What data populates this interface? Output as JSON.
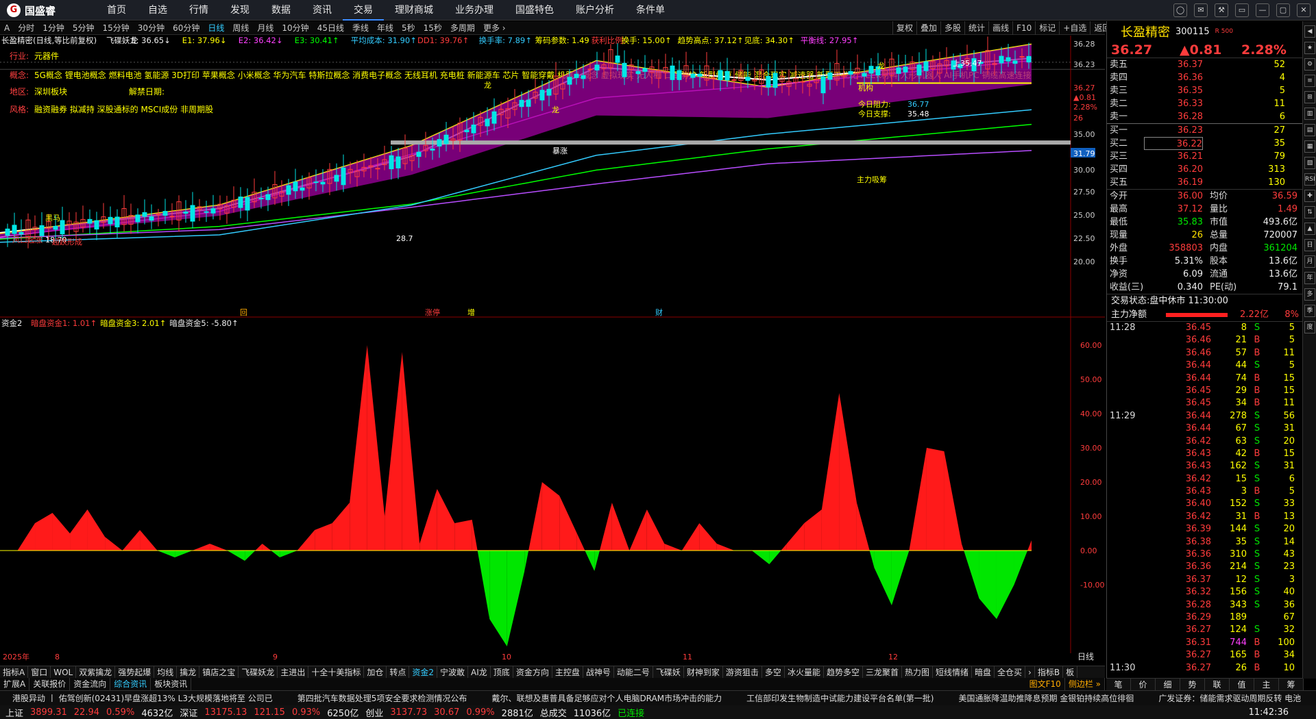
{
  "app": {
    "logo": "国盛睿",
    "logo_mark": "G"
  },
  "menu": [
    "首页",
    "自选",
    "行情",
    "发现",
    "数据",
    "资讯",
    "交易",
    "理财商城",
    "业务办理",
    "国盛特色",
    "账户分析",
    "条件单"
  ],
  "menu_active": 6,
  "window_controls": [
    "◯",
    "✉",
    "⚒",
    "▭",
    "—",
    "▢",
    "✕"
  ],
  "periods": [
    "A",
    "分时",
    "1分钟",
    "5分钟",
    "15分钟",
    "30分钟",
    "60分钟",
    "日线",
    "周线",
    "月线",
    "10分钟",
    "45日线",
    "季线",
    "年线",
    "5秒",
    "15秒",
    "多周期",
    "更多 ›"
  ],
  "period_active": 7,
  "chart_toolbar": [
    "复权",
    "叠加",
    "多股",
    "统计",
    "画线",
    "F10",
    "标记",
    "+自选",
    "返回"
  ],
  "main_legend": [
    {
      "text": "长盈精密(日线,等比前复权)",
      "color": "#eeeeee"
    },
    {
      "text": "飞碟妖龙",
      "color": "#eeeeee"
    },
    {
      "text": "E: 36.65↓",
      "color": "#eeeeee"
    },
    {
      "text": "E1: 37.96↓",
      "color": "#ffff00"
    },
    {
      "text": "E2: 36.42↓",
      "color": "#ff40ff"
    },
    {
      "text": "E3: 30.41↑",
      "color": "#00ff00"
    },
    {
      "text": "平均成本: 31.90↑",
      "color": "#33ccff"
    },
    {
      "text": "DD1: 39.76↑",
      "color": "#ff3c3c"
    },
    {
      "text": "换手率: 7.89↑",
      "color": "#33ccff"
    },
    {
      "text": "筹码参数: 1.49",
      "color": "#ffff00"
    },
    {
      "text": "获利比例:",
      "color": "#ff3c3c"
    },
    {
      "text": "换手: 15.00↑",
      "color": "#ffff00"
    },
    {
      "text": "趋势高点: 37.12↑",
      "color": "#ffff00"
    },
    {
      "text": "见底: 34.30↑",
      "color": "#ffff00"
    },
    {
      "text": "平衡线: 27.95↑",
      "color": "#ff40ff"
    }
  ],
  "info": {
    "industry_label": "行业:",
    "industry": "元器件",
    "concept_label": "概念:",
    "concepts": "5G概念 锂电池概念 燃料电池 氢能源 3D打印 苹果概念 小米概念 华为汽车 特斯拉概念 消费电子概念 无线耳机 充电桩 新能源车 芯片 智能穿戴 机器人概念 虚拟现实 无人机 口罩防护 新型烟草 储能 混合现实 减速器 新型工业化 PEEK材料 人形机器人 AI手机PC 铜缆高速连接",
    "region_label": "地区:",
    "region": "深圳板块",
    "unlock_label": "解禁日期:",
    "unlock": "",
    "style_label": "风格:",
    "style": "融资融券 拟减持 深股通标的 MSCI成份 非周期股"
  },
  "main_yaxis": [
    "36.28",
    "36.23",
    "36.27",
    "▲0.81",
    "2.28%",
    "26",
    "35.00",
    "31.79",
    "30.00",
    "27.50",
    "25.00",
    "22.50",
    "20.00"
  ],
  "chart_annotations": {
    "long1": "龙",
    "long2": "龙",
    "long3": "龙",
    "top": "上35.47",
    "buy_point": "主力吸筹",
    "big_up": "暴涨",
    "today_power": "今日阻力:",
    "today_val": "36.77",
    "short_support": "今日支撑:",
    "support_val": "35.48",
    "jiehe": "机构",
    "bottom_price": "28.7",
    "low_price": "18.70",
    "black_horse": "黑马",
    "wind": "风口起涨",
    "oversold": "超跌形成",
    "evt_zt": "涨停",
    "evt_zeng": "增",
    "evt_cai": "财",
    "evt_box": "回"
  },
  "sub_legend": [
    {
      "text": "资金2",
      "color": "#eeeeee"
    },
    {
      "text": "暗盘资金1: 1.01↑",
      "color": "#ff3c3c"
    },
    {
      "text": "暗盘资金3: 2.01↑",
      "color": "#ffff00"
    },
    {
      "text": "暗盘资金5: -5.80↑",
      "color": "#eeeeee"
    }
  ],
  "sub_yaxis": [
    "60.00",
    "50.00",
    "40.00",
    "30.00",
    "20.00",
    "10.00",
    "0.00",
    "-10.00"
  ],
  "xaxis": [
    "2025年",
    "8",
    "9",
    "10",
    "11",
    "12"
  ],
  "xaxis_right": "日线",
  "bottom_tabs": [
    "指标A",
    "窗口",
    "WOL",
    "双紫擒龙",
    "强势起爆",
    "均线",
    "擒龙",
    "镇店之宝",
    "飞碟妖龙",
    "主进出",
    "十全十美指标",
    "加仓",
    "转点",
    "资金2",
    "宁波敢",
    "AI龙",
    "顶底",
    "资金方向",
    "主控盘",
    "战神号",
    "动能二号",
    "飞碟妖",
    "财神到家",
    "游资狙击",
    "多空",
    "冰火量能",
    "趋势多空",
    "三龙聚首",
    "热力图",
    "短线情绪",
    "暗盘",
    "全仓买",
    "›",
    "指标B",
    "板"
  ],
  "bottom_tabs2": [
    "扩展A",
    "关联报价",
    "资金流向",
    "综合资讯",
    "板块资讯"
  ],
  "bottom_tabs2_right": [
    "图文F10",
    "侧边栏 »"
  ],
  "ticker": [
    "港股异动 丨 佑驾创新(02431)早盘涨超13% L3大规模落地将至 公司已",
    "第四批汽车数据处理5项安全要求检测情况公布",
    "戴尔、联想及惠普具备足够应对个人电脑DRAM市场冲击的能力",
    "工信部印发生物制造中试能力建设平台名单(第一批)",
    "美国通胀降温助推降息预期 金银铂持续高位徘徊",
    "广发证券：储能需求驱动周期反转 电池"
  ],
  "status": {
    "sh_label": "上证",
    "sh": "3899.31",
    "sh_chg": "22.94",
    "sh_pct": "0.59%",
    "sh_amt": "4632亿",
    "sz_label": "深证",
    "sz": "13175.13",
    "sz_chg": "121.15",
    "sz_pct": "0.93%",
    "sz_amt": "6250亿",
    "cy_label": "创业",
    "cy": "3137.73",
    "cy_chg": "30.67",
    "cy_pct": "0.99%",
    "cy_amt": "2881亿",
    "total_label": "总成交",
    "total": "11036亿",
    "conn": "已连接",
    "time": "11:42:36"
  },
  "quote": {
    "name": "长盈精密",
    "code": "300115",
    "tag": "R 500",
    "price": "36.27",
    "change": "▲0.81",
    "pct": "2.28%",
    "asks": [
      {
        "label": "卖五",
        "price": "36.37",
        "vol": "52"
      },
      {
        "label": "卖四",
        "price": "36.36",
        "vol": "4"
      },
      {
        "label": "卖三",
        "price": "36.35",
        "vol": "5"
      },
      {
        "label": "卖二",
        "price": "36.33",
        "vol": "11"
      },
      {
        "label": "卖一",
        "price": "36.28",
        "vol": "6"
      }
    ],
    "bids": [
      {
        "label": "买一",
        "price": "36.23",
        "vol": "27"
      },
      {
        "label": "买二",
        "price": "36.22",
        "vol": "35"
      },
      {
        "label": "买三",
        "price": "36.21",
        "vol": "79"
      },
      {
        "label": "买四",
        "price": "36.20",
        "vol": "313"
      },
      {
        "label": "买五",
        "price": "36.19",
        "vol": "130"
      }
    ],
    "stats": [
      {
        "l1": "今开",
        "v1": "36.00",
        "c1": "red",
        "l2": "均价",
        "v2": "36.59",
        "c2": "red"
      },
      {
        "l1": "最高",
        "v1": "37.12",
        "c1": "red",
        "l2": "量比",
        "v2": "1.49",
        "c2": "red"
      },
      {
        "l1": "最低",
        "v1": "35.83",
        "c1": "green",
        "l2": "市值",
        "v2": "493.6亿",
        "c2": "white"
      },
      {
        "l1": "现量",
        "v1": "26",
        "c1": "yellow",
        "l2": "总量",
        "v2": "720007",
        "c2": "white"
      },
      {
        "l1": "外盘",
        "v1": "358803",
        "c1": "red",
        "l2": "内盘",
        "v2": "361204",
        "c2": "green"
      },
      {
        "l1": "换手",
        "v1": "5.31%",
        "c1": "white",
        "l2": "股本",
        "v2": "13.6亿",
        "c2": "white"
      },
      {
        "l1": "净资",
        "v1": "6.09",
        "c1": "white",
        "l2": "流通",
        "v2": "13.6亿",
        "c2": "white"
      },
      {
        "l1": "收益(三)",
        "v1": "0.340",
        "c1": "white",
        "l2": "PE(动)",
        "v2": "79.1",
        "c2": "white"
      }
    ],
    "trade_state_label": "交易状态:",
    "trade_state": "盘中休市 11:30:00",
    "main_net_label": "主力净额",
    "main_net": "2.22亿",
    "main_net_pct": "8%",
    "ticks": [
      {
        "t": "11:28",
        "p": "36.45",
        "v": "8",
        "bs": "S",
        "n": "5"
      },
      {
        "t": "",
        "p": "36.46",
        "v": "21",
        "bs": "B",
        "n": "5"
      },
      {
        "t": "",
        "p": "36.46",
        "v": "57",
        "bs": "B",
        "n": "11"
      },
      {
        "t": "",
        "p": "36.44",
        "v": "44",
        "bs": "S",
        "n": "5"
      },
      {
        "t": "",
        "p": "36.44",
        "v": "74",
        "bs": "B",
        "n": "15"
      },
      {
        "t": "",
        "p": "36.45",
        "v": "29",
        "bs": "B",
        "n": "15"
      },
      {
        "t": "",
        "p": "36.45",
        "v": "34",
        "bs": "B",
        "n": "11"
      },
      {
        "t": "11:29",
        "p": "36.44",
        "v": "278",
        "bs": "S",
        "n": "56"
      },
      {
        "t": "",
        "p": "36.44",
        "v": "67",
        "bs": "S",
        "n": "31"
      },
      {
        "t": "",
        "p": "36.42",
        "v": "63",
        "bs": "S",
        "n": "20"
      },
      {
        "t": "",
        "p": "36.43",
        "v": "42",
        "bs": "B",
        "n": "15"
      },
      {
        "t": "",
        "p": "36.43",
        "v": "162",
        "bs": "S",
        "n": "31"
      },
      {
        "t": "",
        "p": "36.42",
        "v": "15",
        "bs": "S",
        "n": "6"
      },
      {
        "t": "",
        "p": "36.43",
        "v": "3",
        "bs": "B",
        "n": "5"
      },
      {
        "t": "",
        "p": "36.40",
        "v": "152",
        "bs": "S",
        "n": "33"
      },
      {
        "t": "",
        "p": "36.42",
        "v": "31",
        "bs": "B",
        "n": "13"
      },
      {
        "t": "",
        "p": "36.39",
        "v": "144",
        "bs": "S",
        "n": "20"
      },
      {
        "t": "",
        "p": "36.38",
        "v": "35",
        "bs": "S",
        "n": "14"
      },
      {
        "t": "",
        "p": "36.36",
        "v": "310",
        "bs": "S",
        "n": "43"
      },
      {
        "t": "",
        "p": "36.36",
        "v": "214",
        "bs": "S",
        "n": "23"
      },
      {
        "t": "",
        "p": "36.37",
        "v": "12",
        "bs": "S",
        "n": "3"
      },
      {
        "t": "",
        "p": "36.32",
        "v": "156",
        "bs": "S",
        "n": "40"
      },
      {
        "t": "",
        "p": "36.28",
        "v": "343",
        "bs": "S",
        "n": "36"
      },
      {
        "t": "",
        "p": "36.29",
        "v": "189",
        "bs": "",
        "n": "67"
      },
      {
        "t": "",
        "p": "36.27",
        "v": "124",
        "bs": "S",
        "n": "32"
      },
      {
        "t": "",
        "p": "36.31",
        "v": "744",
        "bs": "B",
        "n": "100"
      },
      {
        "t": "",
        "p": "36.27",
        "v": "165",
        "bs": "B",
        "n": "34"
      },
      {
        "t": "11:30",
        "p": "36.27",
        "v": "26",
        "bs": "B",
        "n": "10"
      }
    ],
    "bottom_tabs": [
      "笔",
      "价",
      "细",
      "势",
      "联",
      "值",
      "主",
      "筹"
    ]
  },
  "sidebar": [
    "◀",
    "★",
    "⚙",
    "≡",
    "⊞",
    "▥",
    "▤",
    "▦",
    "▧",
    "RSI",
    "✚",
    "⇅",
    "▲",
    "日",
    "月",
    "年",
    "多",
    "季",
    "度"
  ],
  "chart_data": {
    "type": "line",
    "title": "长盈精密(日线,等比前复权)",
    "xlabel": "",
    "ylabel": "",
    "x": [
      "2025-07",
      "2025-08",
      "2025-09",
      "2025-10",
      "2025-11",
      "2025-12"
    ],
    "ylim": [
      18,
      38
    ],
    "series": [
      {
        "name": "E",
        "values": [
          20.2,
          22.5,
          27.4,
          35.8,
          34.6,
          36.65
        ]
      },
      {
        "name": "E1",
        "values": [
          20.1,
          22.8,
          28.4,
          36.4,
          33.9,
          37.96
        ]
      },
      {
        "name": "E2",
        "values": [
          19.8,
          22.2,
          27.6,
          32.9,
          34.1,
          36.42
        ]
      },
      {
        "name": "E3",
        "values": [
          19.6,
          20.8,
          22.9,
          26.1,
          28.1,
          30.41
        ]
      },
      {
        "name": "平衡线",
        "values": [
          19.7,
          20.5,
          22.6,
          24.8,
          26.7,
          27.95
        ]
      }
    ],
    "sub": {
      "type": "area",
      "ylim": [
        -28,
        62
      ],
      "values": [
        0,
        0,
        8,
        11,
        5,
        12,
        4,
        0,
        6,
        0,
        -2,
        0,
        2,
        0,
        -3,
        2,
        -2,
        0,
        6,
        8,
        14,
        60,
        10,
        58,
        2,
        18,
        8,
        9,
        -20,
        -28,
        -6,
        20,
        16,
        5,
        -6,
        14,
        0,
        12,
        2,
        0,
        8,
        2,
        0,
        0,
        -4,
        2,
        8,
        12,
        46,
        14,
        -5,
        -16,
        0,
        30,
        29,
        2,
        -14,
        -20,
        -10,
        3
      ]
    }
  }
}
